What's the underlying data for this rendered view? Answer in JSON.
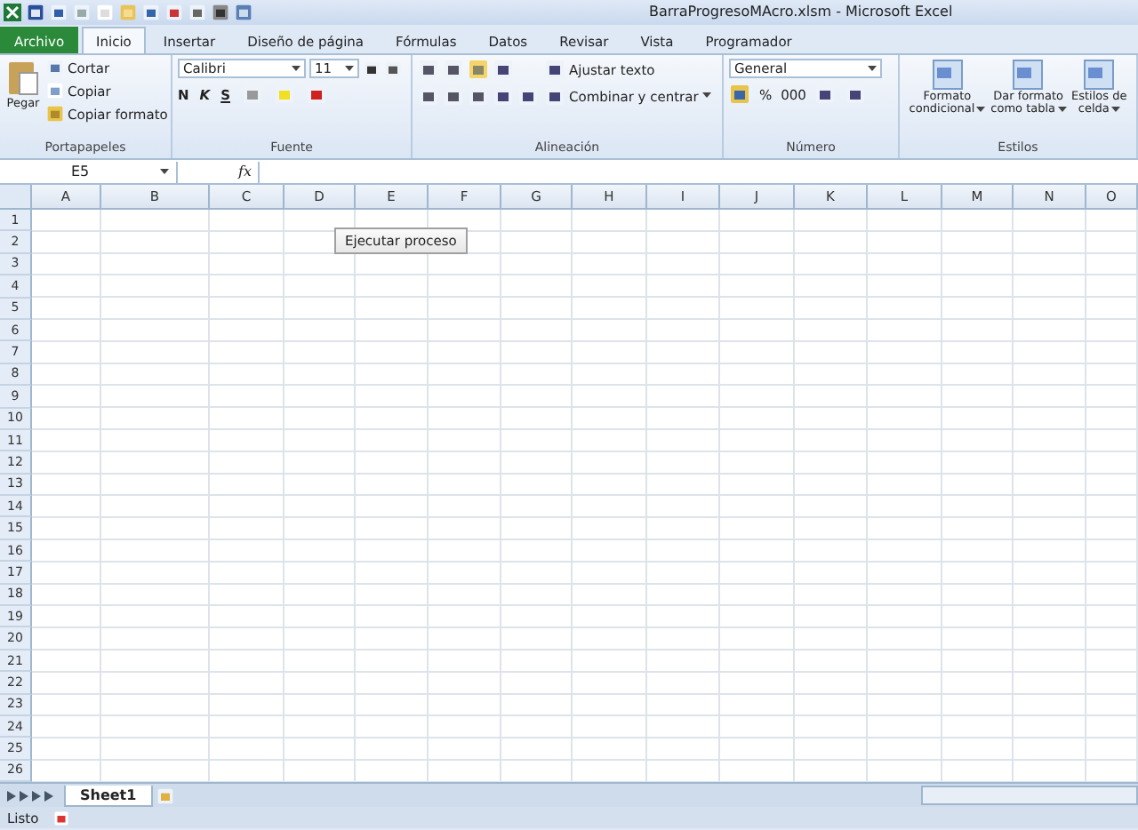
{
  "window": {
    "title": "BarraProgresoMAcro.xlsm  -  Microsoft Excel"
  },
  "tabs": [
    {
      "label": "Archivo",
      "kind": "file",
      "selected": false
    },
    {
      "label": "Inicio",
      "kind": "tab",
      "selected": true
    },
    {
      "label": "Insertar",
      "kind": "tab",
      "selected": false
    },
    {
      "label": "Diseño de página",
      "kind": "tab",
      "selected": false
    },
    {
      "label": "Fórmulas",
      "kind": "tab",
      "selected": false
    },
    {
      "label": "Datos",
      "kind": "tab",
      "selected": false
    },
    {
      "label": "Revisar",
      "kind": "tab",
      "selected": false
    },
    {
      "label": "Vista",
      "kind": "tab",
      "selected": false
    },
    {
      "label": "Programador",
      "kind": "tab",
      "selected": false
    }
  ],
  "ribbon": {
    "clipboard": {
      "title": "Portapapeles",
      "paste": "Pegar",
      "cut": "Cortar",
      "copy": "Copiar",
      "format_painter": "Copiar formato"
    },
    "font": {
      "title": "Fuente",
      "font_name": "Calibri",
      "font_size": "11",
      "bold": "N",
      "italic": "K",
      "underline": "S"
    },
    "alignment": {
      "title": "Alineación",
      "wrap_text": "Ajustar texto",
      "merge_center": "Combinar y centrar"
    },
    "number": {
      "title": "Número",
      "format": "General",
      "percent": "%",
      "thousands": "000"
    },
    "styles": {
      "title": "Estilos",
      "buttons": [
        {
          "line1": "Formato",
          "line2": "condicional"
        },
        {
          "line1": "Dar formato",
          "line2": "como tabla"
        },
        {
          "line1": "Estilos de",
          "line2": "celda"
        }
      ]
    }
  },
  "formula_bar": {
    "name_box": "E5",
    "fx": "fx"
  },
  "columns": [
    "A",
    "B",
    "C",
    "D",
    "E",
    "F",
    "G",
    "H",
    "I",
    "J",
    "K",
    "L",
    "M",
    "N",
    "O"
  ],
  "rows": [
    "1",
    "2",
    "3",
    "4",
    "5",
    "6",
    "7",
    "8",
    "9",
    "10",
    "11",
    "12",
    "13",
    "14",
    "15",
    "16",
    "17",
    "18",
    "19",
    "20",
    "21",
    "22",
    "23",
    "24",
    "25",
    "26"
  ],
  "macro_button": {
    "label": "Ejecutar proceso"
  },
  "sheet_tabs": [
    {
      "label": "Sheet1",
      "selected": true
    }
  ],
  "status_bar": {
    "text": "Listo"
  }
}
